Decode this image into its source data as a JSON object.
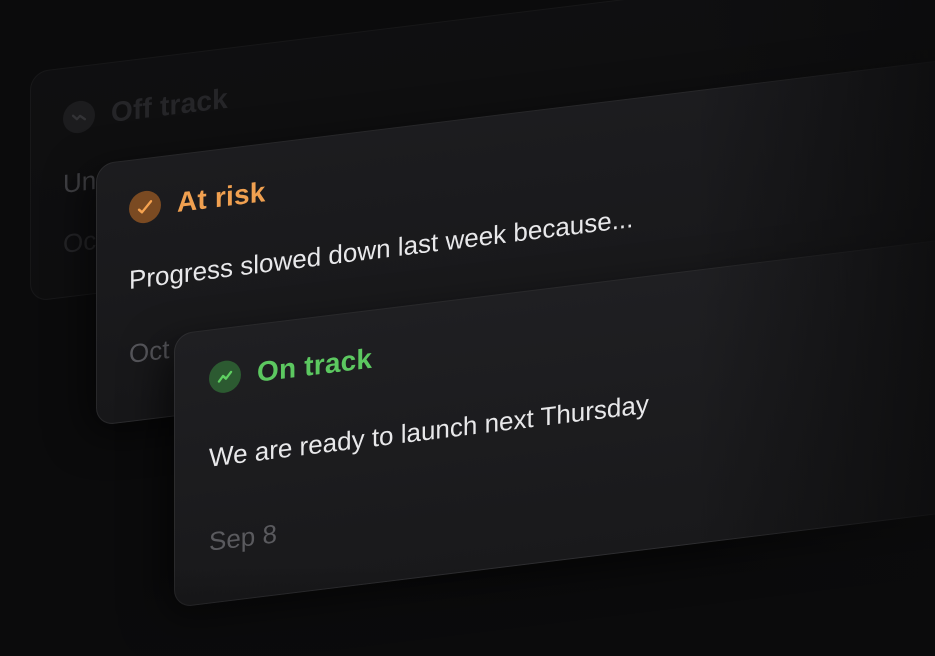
{
  "cards": [
    {
      "status": "Off track",
      "status_icon": "off-track-icon",
      "color": "#3c3c40",
      "message": "Un",
      "date": "Oc"
    },
    {
      "status": "At risk",
      "status_icon": "at-risk-icon",
      "color": "#f0a050",
      "message": "Progress slowed down last week because...",
      "date": "Oct"
    },
    {
      "status": "On track",
      "status_icon": "on-track-icon",
      "color": "#5cc860",
      "message": "We are ready to launch next Thursday",
      "date": "Sep 8"
    }
  ]
}
